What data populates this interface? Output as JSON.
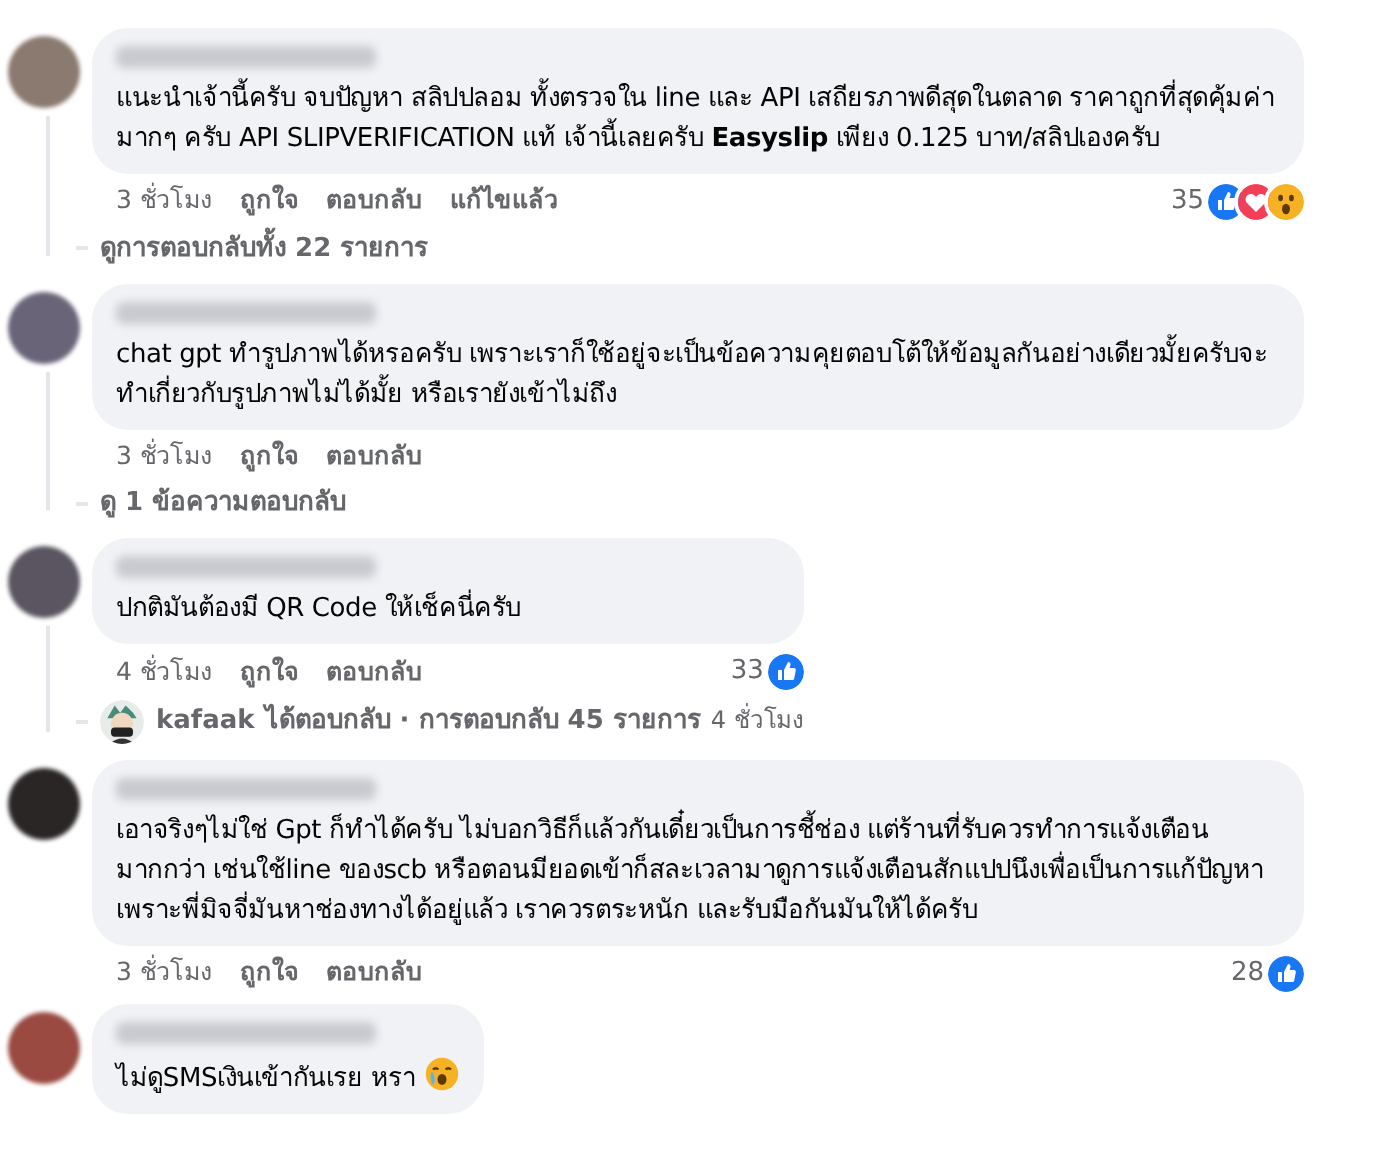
{
  "comments": [
    {
      "text": "แนะนำเจ้านี้ครับ จบปัญหา สลิปปลอม ทั้งตรวจใน line และ API เสถียรภาพดีสุดในตลาด ราคาถูกที่สุดคุ้มค่ามากๆ ครับ API SLIPVERIFICATION แท้ เจ้านี้เลยครับ **Easyslip** เพียง 0.125 บาท/สลิปเองครับ",
      "actions": [
        "3 ชั่วโมง",
        "ถูกใจ",
        "ตอบกลับ",
        "แก้ไขแล้ว"
      ],
      "reaction_count": "35",
      "reactions": [
        {
          "kind": "like"
        },
        {
          "kind": "love"
        },
        {
          "kind": "wow"
        }
      ],
      "replies": {
        "kind": "link",
        "text": "ดูการตอบกลับทั้ง 22 รายการ"
      }
    },
    {
      "text": "chat gpt ทำรูปภาพได้หรอครับ เพราะเราก็ใช้อยู่จะเป็นข้อความคุยตอบโต้ให้ข้อมูลกันอย่างเดียวมั้ยครับจะทำเกี่ยวกับรูปภาพไม่ได้มั้ย หรือเรายังเข้าไม่ถึง",
      "actions": [
        "3 ชั่วโมง",
        "ถูกใจ",
        "ตอบกลับ"
      ],
      "replies": {
        "kind": "link",
        "text": "ดู 1 ข้อความตอบกลับ"
      }
    },
    {
      "text": "ปกติมันต้องมี QR Code ให้เช็คนี่ครับ",
      "actions": [
        "4 ชั่วโมง",
        "ถูกใจ",
        "ตอบกลับ"
      ],
      "reaction_count": "33",
      "reactions": [
        {
          "kind": "like"
        }
      ],
      "replies": {
        "kind": "replier",
        "name": "kafaak",
        "text": "ได้ตอบกลับ · การตอบกลับ 45 รายการ",
        "time": "4 ชั่วโมง"
      }
    },
    {
      "text": "เอาจริงๆไม่ใช่ Gpt ก็ทำได้ครับ ไม่บอกวิธีก็แล้วกันเดี๋ยวเป็นการชี้ช่อง แต่ร้านที่รับควรทำการแจ้งเตือนมากกว่า เช่นใช้line ของscb หรือตอนมียอดเข้าก็สละเวลามาดูการแจ้งเตือนสักแปปนึงเพื่อเป็นการแก้ปัญหา เพราะพี่มิจจี่มันหาช่องทางได้อยู่แล้ว เราควรตระหนัก และรับมือกันมันให้ได้ครับ",
      "actions": [
        "3 ชั่วโมง",
        "ถูกใจ",
        "ตอบกลับ"
      ],
      "reaction_count": "28",
      "reactions": [
        {
          "kind": "like"
        }
      ]
    },
    {
      "text": "ไม่ดูSMSเงินเข้ากันเรย หรา",
      "emoji": {
        "kind": "crying_face"
      }
    }
  ]
}
